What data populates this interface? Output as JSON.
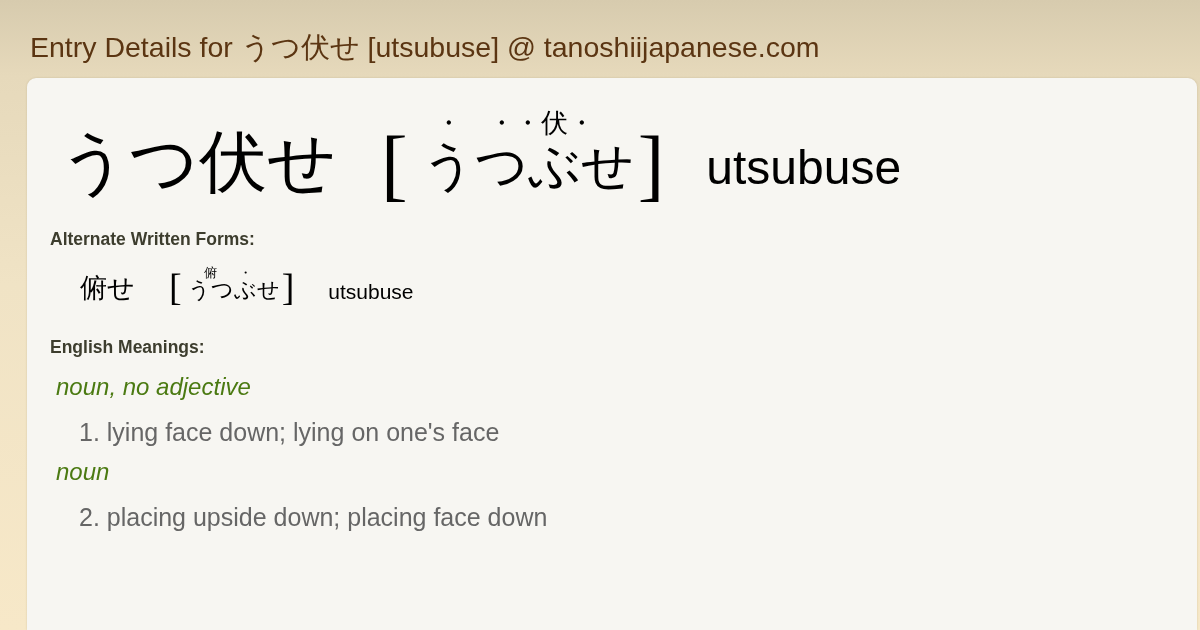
{
  "page_title": "Entry Details for うつ伏せ [utsubuse] @ tanoshiijapanese.com",
  "entry": {
    "written": "うつ伏せ",
    "reading": {
      "open": "[",
      "segments": [
        {
          "base": "う",
          "ruby": "・"
        },
        {
          "base": "つ",
          "ruby": "・"
        },
        {
          "base": "ぶ",
          "ruby": "・伏・"
        },
        {
          "base": "せ"
        }
      ],
      "close": "]"
    },
    "romaji": "utsubuse"
  },
  "alternate_forms": {
    "label": "Alternate Written Forms:",
    "items": [
      {
        "written": "俯せ",
        "reading": {
          "open": "[",
          "segments": [
            {
              "base": "うつ",
              "ruby": "俯"
            },
            {
              "base": "ぶ",
              "ruby": "・"
            },
            {
              "base": "せ"
            }
          ],
          "close": "]"
        },
        "romaji": "utsubuse"
      }
    ]
  },
  "meanings": {
    "label": "English Meanings:",
    "groups": [
      {
        "part_of_speech": "noun, no adjective",
        "glosses": [
          "1. lying face down; lying on one's face"
        ]
      },
      {
        "part_of_speech": "noun",
        "glosses": [
          "2. placing upside down; placing face down"
        ]
      }
    ]
  }
}
